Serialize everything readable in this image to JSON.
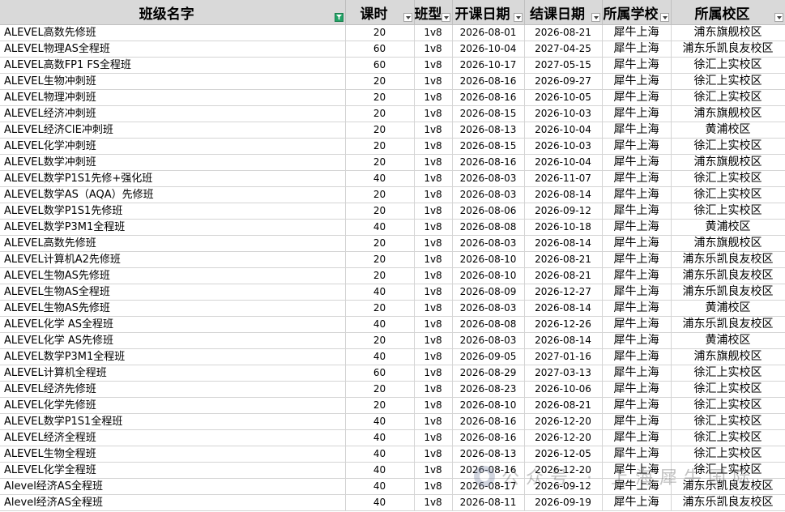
{
  "headers": [
    {
      "label": "班级名字",
      "filter_active": true
    },
    {
      "label": "课时",
      "filter_active": false
    },
    {
      "label": "班型",
      "filter_active": false
    },
    {
      "label": "开课日期",
      "filter_active": false
    },
    {
      "label": "结课日期",
      "filter_active": false
    },
    {
      "label": "所属学校",
      "filter_active": false
    },
    {
      "label": "所属校区",
      "filter_active": false
    }
  ],
  "rows": [
    [
      "ALEVEL高数先修班",
      "20",
      "1v8",
      "2026-08-01",
      "2026-08-21",
      "犀牛上海",
      "浦东旗舰校区"
    ],
    [
      "ALEVEL物理AS全程班",
      "60",
      "1v8",
      "2026-10-04",
      "2027-04-25",
      "犀牛上海",
      "浦东乐凯良友校区"
    ],
    [
      "ALEVEL高数FP1 FS全程班",
      "60",
      "1v8",
      "2026-10-17",
      "2027-05-15",
      "犀牛上海",
      "徐汇上实校区"
    ],
    [
      "ALEVEL生物冲刺班",
      "20",
      "1v8",
      "2026-08-16",
      "2026-09-27",
      "犀牛上海",
      "徐汇上实校区"
    ],
    [
      "ALEVEL物理冲刺班",
      "20",
      "1v8",
      "2026-08-16",
      "2026-10-05",
      "犀牛上海",
      "徐汇上实校区"
    ],
    [
      "ALEVEL经济冲刺班",
      "20",
      "1v8",
      "2026-08-15",
      "2026-10-03",
      "犀牛上海",
      "浦东旗舰校区"
    ],
    [
      "ALEVEL经济CIE冲刺班",
      "20",
      "1v8",
      "2026-08-13",
      "2026-10-04",
      "犀牛上海",
      "黄浦校区"
    ],
    [
      "ALEVEL化学冲刺班",
      "20",
      "1v8",
      "2026-08-15",
      "2026-10-03",
      "犀牛上海",
      "徐汇上实校区"
    ],
    [
      "ALEVEL数学冲刺班",
      "20",
      "1v8",
      "2026-08-16",
      "2026-10-04",
      "犀牛上海",
      "浦东旗舰校区"
    ],
    [
      "ALEVEL数学P1S1先修+强化班",
      "40",
      "1v8",
      "2026-08-03",
      "2026-11-07",
      "犀牛上海",
      "徐汇上实校区"
    ],
    [
      "ALEVEL数学AS（AQA）先修班",
      "20",
      "1v8",
      "2026-08-03",
      "2026-08-14",
      "犀牛上海",
      "徐汇上实校区"
    ],
    [
      "ALEVEL数学P1S1先修班",
      "20",
      "1v8",
      "2026-08-06",
      "2026-09-12",
      "犀牛上海",
      "徐汇上实校区"
    ],
    [
      "ALEVEL数学P3M1全程班",
      "40",
      "1v8",
      "2026-08-08",
      "2026-10-18",
      "犀牛上海",
      "黄浦校区"
    ],
    [
      "ALEVEL高数先修班",
      "20",
      "1v8",
      "2026-08-03",
      "2026-08-14",
      "犀牛上海",
      "浦东旗舰校区"
    ],
    [
      "ALEVEL计算机A2先修班",
      "20",
      "1v8",
      "2026-08-10",
      "2026-08-21",
      "犀牛上海",
      "浦东乐凯良友校区"
    ],
    [
      "ALEVEL生物AS先修班",
      "20",
      "1v8",
      "2026-08-10",
      "2026-08-21",
      "犀牛上海",
      "浦东乐凯良友校区"
    ],
    [
      "ALEVEL生物AS全程班",
      "40",
      "1v8",
      "2026-08-09",
      "2026-12-27",
      "犀牛上海",
      "浦东乐凯良友校区"
    ],
    [
      "ALEVEL生物AS先修班",
      "20",
      "1v8",
      "2026-08-03",
      "2026-08-14",
      "犀牛上海",
      "黄浦校区"
    ],
    [
      "ALEVEL化学 AS全程班",
      "40",
      "1v8",
      "2026-08-08",
      "2026-12-26",
      "犀牛上海",
      "浦东乐凯良友校区"
    ],
    [
      "ALEVEL化学 AS先修班",
      "20",
      "1v8",
      "2026-08-03",
      "2026-08-14",
      "犀牛上海",
      "黄浦校区"
    ],
    [
      "ALEVEL数学P3M1全程班",
      "40",
      "1v8",
      "2026-09-05",
      "2027-01-16",
      "犀牛上海",
      "浦东旗舰校区"
    ],
    [
      "ALEVEL计算机全程班",
      "60",
      "1v8",
      "2026-08-29",
      "2027-03-13",
      "犀牛上海",
      "徐汇上实校区"
    ],
    [
      "ALEVEL经济先修班",
      "20",
      "1v8",
      "2026-08-23",
      "2026-10-06",
      "犀牛上海",
      "徐汇上实校区"
    ],
    [
      "ALEVEL化学先修班",
      "20",
      "1v8",
      "2026-08-10",
      "2026-08-21",
      "犀牛上海",
      "徐汇上实校区"
    ],
    [
      "ALEVEL数学P1S1全程班",
      "40",
      "1v8",
      "2026-08-16",
      "2026-12-20",
      "犀牛上海",
      "徐汇上实校区"
    ],
    [
      "ALEVEL经济全程班",
      "40",
      "1v8",
      "2026-08-16",
      "2026-12-20",
      "犀牛上海",
      "徐汇上实校区"
    ],
    [
      "ALEVEL生物全程班",
      "40",
      "1v8",
      "2026-08-13",
      "2026-12-05",
      "犀牛上海",
      "徐汇上实校区"
    ],
    [
      "ALEVEL化学全程班",
      "40",
      "1v8",
      "2026-08-16",
      "2026-12-20",
      "犀牛上海",
      "徐汇上实校区"
    ],
    [
      "Alevel经济AS全程班",
      "40",
      "1v8",
      "2026-08-17",
      "2026-09-12",
      "犀牛上海",
      "浦东乐凯良友校区"
    ],
    [
      "Alevel经济AS全程班",
      "40",
      "1v8",
      "2026-08-11",
      "2026-09-19",
      "犀牛上海",
      "浦东乐凯良友校区"
    ]
  ],
  "watermark": "公众号 · 上海犀牛国际",
  "colors": {
    "header_bg": "#d9d9d9",
    "gridline": "#d4d4d4",
    "filter_active": "#21a366"
  }
}
